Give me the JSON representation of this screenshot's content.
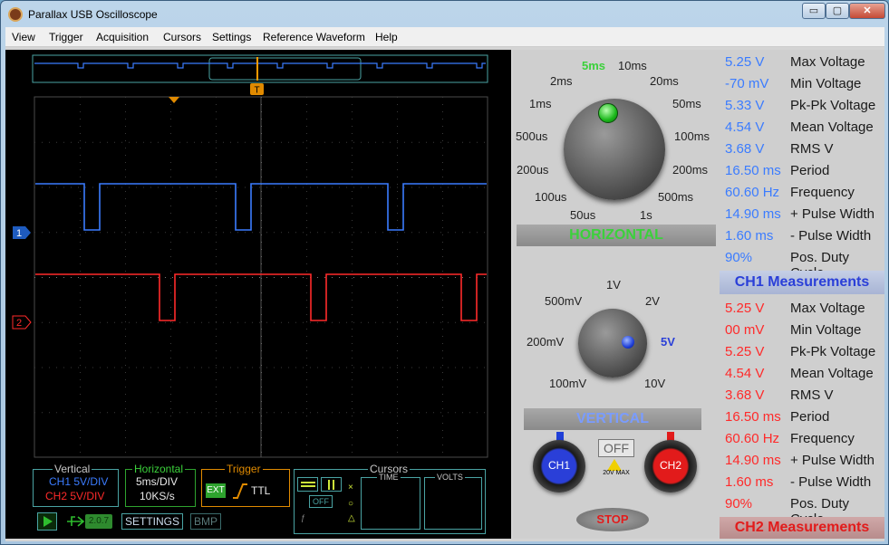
{
  "window": {
    "title": "Parallax USB Oscilloscope"
  },
  "caption_buttons": {
    "minimize": "▭",
    "maximize": "▢",
    "close": "✕"
  },
  "menu": [
    "View",
    "Trigger",
    "Acquisition",
    "Cursors",
    "Settings",
    "Reference Waveform",
    "Help"
  ],
  "trigger_marker": "T",
  "channel_markers": {
    "ch1": "1",
    "ch2": "2"
  },
  "status": {
    "vertical_title": "Vertical",
    "vertical_ch1": "CH1 5V/DIV",
    "vertical_ch2": "CH2 5V/DIV",
    "horizontal_title": "Horizontal",
    "horizontal_div": "5ms/DIV",
    "horizontal_rate": "10KS/s",
    "trigger_title": "Trigger",
    "trigger_source": "EXT",
    "trigger_type": "TTL",
    "cursors_title": "Cursors",
    "cursors_off": "OFF",
    "cursors_time": "TIME",
    "cursors_volts": "VOLTS",
    "version": "2.0.7",
    "settings_button": "SETTINGS",
    "bmp_button": "BMP"
  },
  "horizontal": {
    "title": "HORIZONTAL",
    "selected": "5ms",
    "labels": [
      "5ms",
      "10ms",
      "20ms",
      "50ms",
      "100ms",
      "200ms",
      "500ms",
      "1s",
      "50us",
      "100us",
      "200us",
      "500us",
      "1ms",
      "2ms"
    ]
  },
  "vertical": {
    "title": "VERTICAL",
    "selected": "5V",
    "labels": [
      "1V",
      "2V",
      "5V",
      "10V",
      "100mV",
      "200mV",
      "500mV"
    ]
  },
  "buttons": {
    "ch1": "CH1",
    "ch2": "CH2",
    "off": "OFF",
    "max": "20V MAX",
    "stop": "STOP"
  },
  "ch1_measurements": {
    "title": "CH1 Measurements",
    "rows": [
      {
        "value": "5.25 V",
        "label": "Max Voltage"
      },
      {
        "value": "-70 mV",
        "label": "Min Voltage"
      },
      {
        "value": "5.33 V",
        "label": "Pk-Pk Voltage"
      },
      {
        "value": "4.54 V",
        "label": "Mean Voltage"
      },
      {
        "value": "3.68 V",
        "label": "RMS V"
      },
      {
        "value": "16.50 ms",
        "label": "Period"
      },
      {
        "value": "60.60 Hz",
        "label": "Frequency"
      },
      {
        "value": "14.90 ms",
        "label": "+ Pulse Width"
      },
      {
        "value": "1.60 ms",
        "label": "- Pulse Width"
      },
      {
        "value": "90%",
        "label": "Pos. Duty Cycle"
      }
    ]
  },
  "ch2_measurements": {
    "title": "CH2 Measurements",
    "rows": [
      {
        "value": "5.25 V",
        "label": "Max Voltage"
      },
      {
        "value": "00 mV",
        "label": "Min Voltage"
      },
      {
        "value": "5.25 V",
        "label": "Pk-Pk Voltage"
      },
      {
        "value": "4.54 V",
        "label": "Mean Voltage"
      },
      {
        "value": "3.68 V",
        "label": "RMS V"
      },
      {
        "value": "16.50 ms",
        "label": "Period"
      },
      {
        "value": "60.60 Hz",
        "label": "Frequency"
      },
      {
        "value": "14.90 ms",
        "label": "+ Pulse Width"
      },
      {
        "value": "1.60 ms",
        "label": "- Pulse Width"
      },
      {
        "value": "90%",
        "label": "Pos. Duty Cycle"
      }
    ]
  },
  "colors": {
    "ch1": "#3b7cff",
    "ch2": "#ff2a2a",
    "grid": "#3a3a3a",
    "accent_green": "#3bd13b"
  }
}
